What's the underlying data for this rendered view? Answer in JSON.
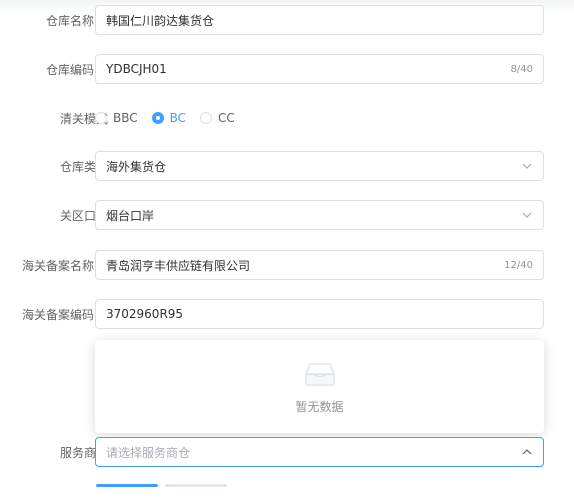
{
  "form": {
    "warehouse_name": {
      "label": "仓库名称",
      "value": "韩国仁川韵达集货仓"
    },
    "warehouse_code": {
      "label": "仓库编码",
      "value": "YDBCJH01",
      "count": "8/40"
    },
    "clearance_mode": {
      "label": "清关模式",
      "options": [
        "BBC",
        "BC",
        "CC"
      ],
      "selected": "BC"
    },
    "warehouse_type": {
      "label": "仓库类型",
      "value": "海外集货仓"
    },
    "customs_port": {
      "label": "关区口岸",
      "value": "烟台口岸"
    },
    "customs_record_name": {
      "label": "海关备案名称",
      "value": "青岛润亨丰供应链有限公司",
      "count": "12/40"
    },
    "customs_record_code": {
      "label": "海关备案编码",
      "value": "3702960R95"
    },
    "dropdown_empty_text": "暂无数据",
    "service_provider": {
      "label": "服务商仓",
      "placeholder": "请选择服务商仓"
    }
  },
  "colors": {
    "accent": "#409eff",
    "border": "#dcdfe6",
    "label": "#606266"
  },
  "icons": {
    "help": "question-circle-icon",
    "chevron": "chevron-down-icon",
    "empty": "empty-box-icon"
  }
}
